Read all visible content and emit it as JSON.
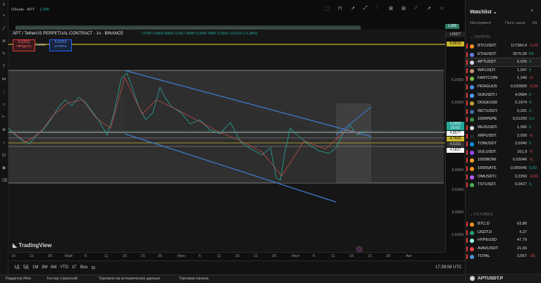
{
  "top": {
    "volume_label": "Объём · APT",
    "volume_value": "1,096",
    "volume_right_value": "1,096"
  },
  "chart": {
    "symbol_title": "APT / TetherUS PERPETUAL CONTRACT · 1ч · BINANCE",
    "ohlc": "ОТКР 5,0409  МАКС 5,0517  МИН 5,0406  ЗАКР 5,0253  +0,0103 (+1,34%)",
    "sell_price": "5,0252",
    "sell_label": "ПРОДАТЬ",
    "spread": "0,0001",
    "buy_price": "5,0253",
    "buy_label": "КУПИТЬ",
    "currency": "USDT",
    "watermark": "TradingView",
    "yellow_level": "6,8515",
    "price_tag": "5,0253",
    "price_tag_time": "20:52",
    "level_a": "4,8577",
    "level_b": "4,7643",
    "level_c": "4,6311",
    "level_d": "4,5837",
    "y_ticks": [
      "6,0000",
      "5,5000",
      "5,0000",
      "4,5000",
      "4,0000",
      "3,5000",
      "3,0000",
      "2,5000"
    ],
    "x_ticks": [
      "16",
      "21",
      "26",
      "Май",
      "6",
      "11",
      "16",
      "21",
      "26",
      "Июн",
      "6",
      "11",
      "16",
      "21",
      "26",
      "Июл",
      "6",
      "11",
      "16",
      "21",
      "26",
      "Авг"
    ]
  },
  "bottom": {
    "timeframes": [
      "1Д",
      "5Д",
      "1М",
      "3М",
      "6М",
      "YTD",
      "1Г",
      "Все"
    ],
    "clock": "17:39:08 UTC"
  },
  "panel_tabs": [
    "Редактор Pine",
    "Тестер стратегий",
    "Торговля на исторических данных",
    "Торговая панель"
  ],
  "watchlist": {
    "title": "Watchlist",
    "col_symbol": "Инструмент",
    "col_price": "Посл. цена",
    "col_change": "Из",
    "section_crypto": "CRYPTO",
    "section_futures": "FUTURES",
    "rows": [
      {
        "sym": "BTCUSDT.",
        "price": "117384,4",
        "change": "-2,43",
        "color": "#f7931a",
        "chg_color": "#e04848"
      },
      {
        "sym": "ETHUSDT.",
        "price": "3076,90",
        "change": "64",
        "color": "#627eea",
        "chg_color": "#22ab94"
      },
      {
        "sym": "APTUSDT.",
        "price": "5,025",
        "change": "0,",
        "color": "#d1d4dc",
        "chg_color": "#22ab94"
      },
      {
        "sym": "WIFUSDT.",
        "price": "1,047",
        "change": "0",
        "color": "#c8936b",
        "chg_color": "#22ab94"
      },
      {
        "sym": "FARTCOIN",
        "price": "1,246",
        "change": "-0,",
        "color": "#7dbf4c",
        "chg_color": "#e04848"
      },
      {
        "sym": "PENGUUS",
        "price": "0,033899",
        "change": "-0,00",
        "color": "#4a90e2",
        "chg_color": "#e04848"
      },
      {
        "sym": "SUIUSDT.I",
        "price": "4,0584",
        "change": "0",
        "color": "#4da2ff",
        "chg_color": "#22ab94"
      },
      {
        "sym": "DOGEUSD",
        "price": "0,1974",
        "change": "0,",
        "color": "#c2a633",
        "chg_color": "#22ab94"
      },
      {
        "sym": "WCTUSDT.",
        "price": "0,331",
        "change": "0,",
        "color": "#3b6ea5",
        "chg_color": "#22ab94"
      },
      {
        "sym": "1000PEPE",
        "price": "0,01260",
        "change": "0,0",
        "color": "#3e8e41",
        "chg_color": "#22ab94"
      },
      {
        "sym": "WLDUSDT.",
        "price": "1,066",
        "change": "0",
        "color": "#dddddd",
        "chg_color": "#22ab94"
      },
      {
        "sym": "XRPUSDT.",
        "price": "2,930",
        "change": "-0,",
        "color": "#23292f",
        "chg_color": "#e04848"
      },
      {
        "sym": "TONUSDT",
        "price": "3,0340",
        "change": "0",
        "color": "#0098ea",
        "chg_color": "#22ab94"
      },
      {
        "sym": "SOLUSDT.",
        "price": "161,9",
        "change": "-0",
        "color": "#9945ff",
        "chg_color": "#e04848"
      },
      {
        "sym": "1000BONI",
        "price": "0,03046",
        "change": "-0,",
        "color": "#f4a02b",
        "chg_color": "#e04848"
      },
      {
        "sym": "1000SATS",
        "price": "0,000045",
        "change": "0,00",
        "color": "#f7931a",
        "chg_color": "#22ab94"
      },
      {
        "sym": "OMUSDT.I",
        "price": "0,2350",
        "change": "-0,00",
        "color": "#b45cff",
        "chg_color": "#e04848"
      },
      {
        "sym": "TSTUSDT.",
        "price": "0,0427",
        "change": "0,",
        "color": "#4caf50",
        "chg_color": "#22ab94"
      }
    ],
    "futures_rows": [
      {
        "sym": "BTC.D",
        "price": "63,86",
        "change": "-",
        "color": "#f7931a",
        "chg_color": "#e04848"
      },
      {
        "sym": "USDT.D",
        "price": "4,37",
        "change": "",
        "color": "#26a17b",
        "chg_color": "#22ab94"
      },
      {
        "sym": "HYPEUSD",
        "price": "47,70",
        "change": "",
        "color": "#97fce4",
        "chg_color": "#22ab94"
      },
      {
        "sym": "AVAXUSDT",
        "price": "21,66",
        "change": "",
        "color": "#e84142",
        "chg_color": "#22ab94"
      },
      {
        "sym": "TOTAL",
        "price": "3,66T",
        "change": "-29,",
        "color": "#4a90e2",
        "chg_color": "#e04848"
      }
    ],
    "footer_symbol": "APTUSDT.P"
  }
}
